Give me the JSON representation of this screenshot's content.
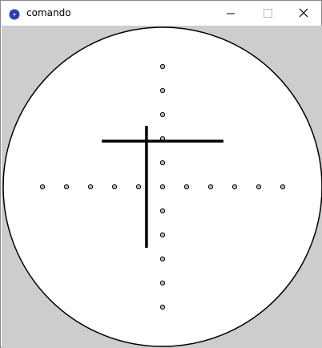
{
  "window": {
    "title": "comando",
    "icon": "python-ball-icon",
    "controls": [
      "minimize-icon",
      "maximize-icon",
      "close-icon"
    ]
  },
  "colors": {
    "titlebar_bg": "#ffffff",
    "canvas_bg": "#cdcdcd",
    "disc_fill": "#ffffff",
    "ink": "#000000",
    "dot_fill": "#bdbdbd",
    "icon_blue": "#2a3fb5"
  },
  "scope": {
    "axis_dots": {
      "horizontal_count": 11,
      "vertical_count": 11
    },
    "crosshair": {
      "vertical_offset_dots": -0.67,
      "horizontal_offset_dots": -1.9
    }
  }
}
